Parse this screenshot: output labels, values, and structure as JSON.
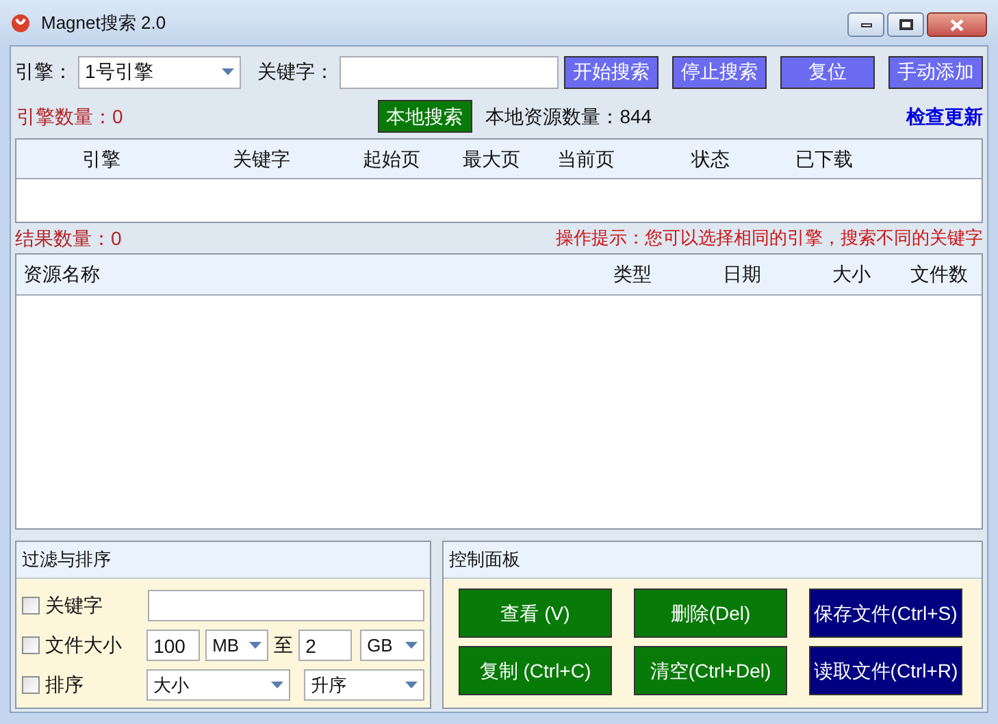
{
  "window": {
    "title": "Magnet搜索 2.0"
  },
  "search_bar": {
    "engine_label": "引擎：",
    "engine_value": "1号引擎",
    "keyword_label": "关键字：",
    "buttons": [
      {
        "label": "开始搜索",
        "color": "#6b6bf0"
      },
      {
        "label": "停止搜索",
        "color": "#6b6bf0"
      },
      {
        "label": "复位",
        "color": "#6b6bf0"
      },
      {
        "label": "手动添加",
        "color": "#6b6bf0"
      }
    ]
  },
  "status_row": {
    "engine_count": "引擎数量：0",
    "local_search_button": {
      "label": "本地搜索",
      "color": "#087a08"
    },
    "local_count": "本地资源数量：844",
    "update_link": "检查更新"
  },
  "engine_table": {
    "columns": [
      "引擎",
      "关键字",
      "起始页",
      "最大页",
      "当前页",
      "状态",
      "已下载"
    ]
  },
  "result_row": {
    "result_count": "结果数量：0",
    "tip": "操作提示：您可以选择相同的引擎，搜索不同的关键字"
  },
  "result_table": {
    "columns": [
      "资源名称",
      "类型",
      "日期",
      "大小",
      "文件数"
    ]
  },
  "filter_panel": {
    "title": "过滤与排序",
    "rows": [
      {
        "kind": "keyword",
        "label": "关键字",
        "checked": false
      },
      {
        "kind": "size",
        "label": "文件大小",
        "checked": false,
        "min": "100",
        "min_unit": "MB",
        "to": "至",
        "max": "2",
        "max_unit": "GB"
      },
      {
        "kind": "sort",
        "label": "排序",
        "checked": false,
        "field": "大小",
        "order": "升序"
      }
    ]
  },
  "control_panel": {
    "title": "控制面板",
    "buttons": [
      {
        "label": "查看 (V)",
        "color": "#087a08"
      },
      {
        "label": "删除(Del)",
        "color": "#087a08"
      },
      {
        "label": "保存文件(Ctrl+S)",
        "color": "#000080"
      },
      {
        "label": "复制 (Ctrl+C)",
        "color": "#087a08"
      },
      {
        "label": "清空(Ctrl+Del)",
        "color": "#087a08"
      },
      {
        "label": "读取文件(Ctrl+R)",
        "color": "#000080"
      }
    ]
  }
}
